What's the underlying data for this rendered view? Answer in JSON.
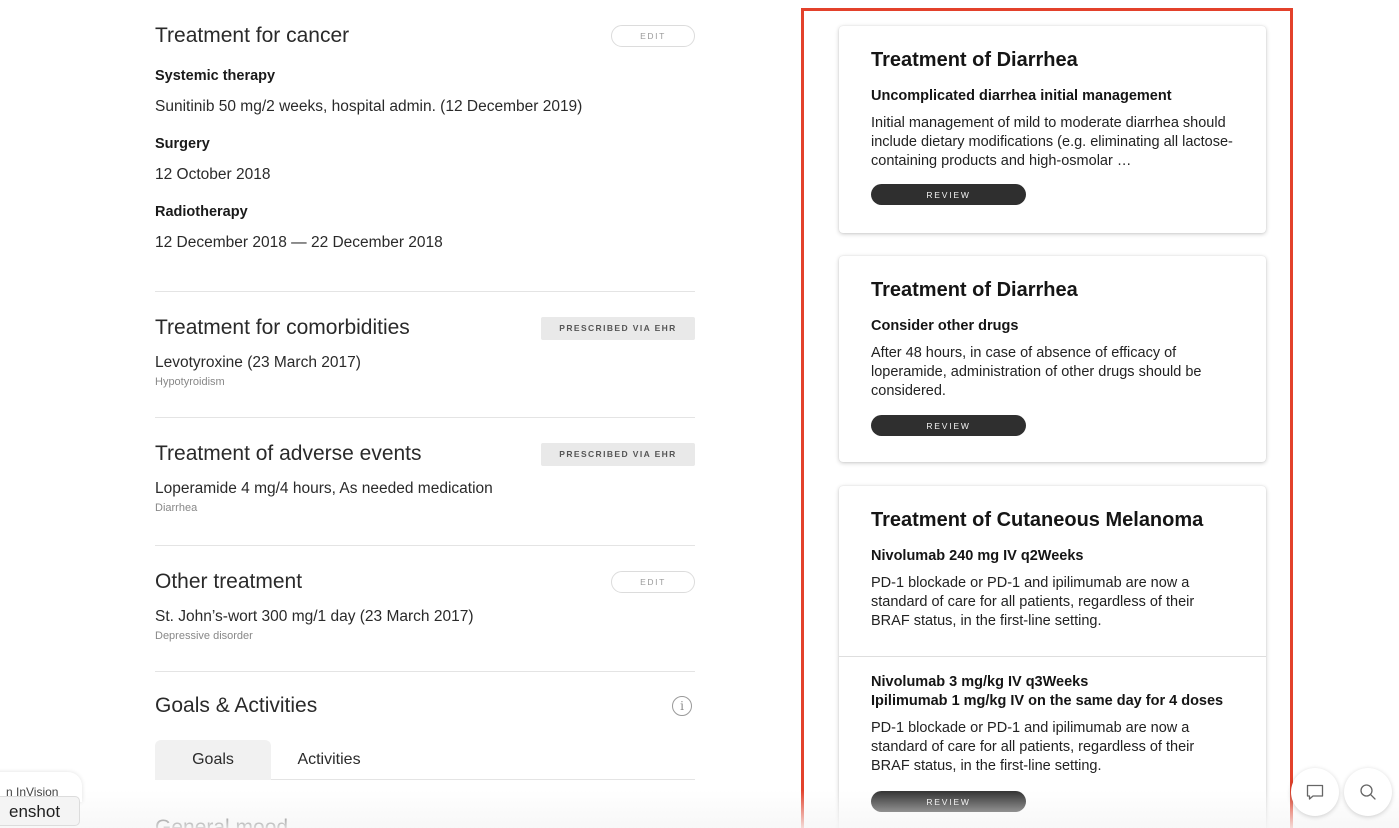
{
  "left": {
    "cancer": {
      "title": "Treatment for cancer",
      "edit_label": "EDIT",
      "systemic_label": "Systemic therapy",
      "systemic_value": "Sunitinib 50 mg/2 weeks, hospital admin. (12 December 2019)",
      "surgery_label": "Surgery",
      "surgery_value": "12 October 2018",
      "radio_label": "Radiotherapy",
      "radio_value": "12 December 2018 — 22 December 2018"
    },
    "comorbidities": {
      "title": "Treatment for comorbidities",
      "badge": "PRESCRIBED VIA EHR",
      "item": "Levotyroxine (23 March 2017)",
      "note": "Hypotyroidism"
    },
    "adverse": {
      "title": "Treatment of adverse events",
      "badge": "PRESCRIBED VIA EHR",
      "item": "Loperamide 4 mg/4 hours, As needed medication",
      "note": "Diarrhea"
    },
    "other": {
      "title": "Other treatment",
      "edit_label": "EDIT",
      "item": "St. John’s-wort 300 mg/1 day (23 March 2017)",
      "note": "Depressive disorder"
    },
    "goals": {
      "title": "Goals & Activities",
      "tabs": [
        "Goals",
        "Activities"
      ],
      "active_tab": "Goals",
      "next_heading_partial": "General mood"
    }
  },
  "cards": [
    {
      "title": "Treatment of Diarrhea",
      "subtitle": "Uncomplicated diarrhea initial management",
      "body": "Initial management of mild to moderate diarrhea should include dietary modifications (e.g. eliminating all lactose-containing products and high-osmolar …",
      "button": "REVIEW"
    },
    {
      "title": "Treatment of Diarrhea",
      "subtitle": "Consider other drugs",
      "body": "After 48 hours, in case of absence of efficacy of loperamide, administration of other drugs should be considered.",
      "button": "REVIEW"
    },
    {
      "title": "Treatment of Cutaneous Melanoma",
      "options": [
        {
          "subtitle": "Nivolumab 240 mg IV q2Weeks",
          "body": "PD-1 blockade or PD-1 and ipilimumab are now a standard of care for all patients, regardless of their BRAF status, in the first-line setting."
        },
        {
          "subtitle_line1": "Nivolumab 3 mg/kg IV q3Weeks",
          "subtitle_line2": "Ipilimumab 1 mg/kg IV on the same day for 4 doses",
          "body": "PD-1 blockade or PD-1 and ipilimumab are now a standard of care for all patients, regardless of their BRAF status, in the first-line setting."
        }
      ],
      "button": "REVIEW"
    }
  ],
  "overlay": {
    "invision_label": "n InVision",
    "screenshot_label": "enshot"
  },
  "icons": {
    "info": "info-icon",
    "comment": "comment-icon",
    "search": "search-icon"
  },
  "colors": {
    "highlight_border": "#e3412b",
    "review_button": "#2f2f2f"
  }
}
